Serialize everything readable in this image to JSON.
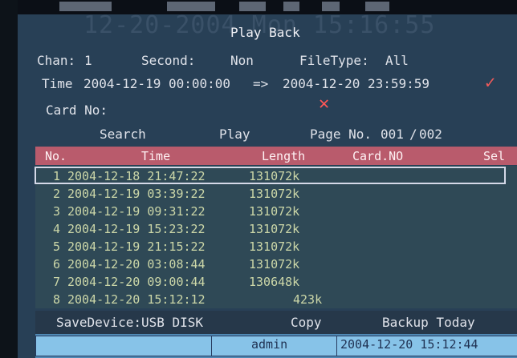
{
  "overlay": {
    "date_time": "12-20-2004 Mon 15:16:55"
  },
  "title": "Play Back",
  "filters": {
    "chan_label": "Chan:",
    "chan_value": "1",
    "second_label": "Second:",
    "second_value": "Non",
    "filetype_label": "FileType:",
    "filetype_value": "All"
  },
  "time_range": {
    "label": "Time",
    "start": "2004-12-19 00:00:00",
    "arrow": "=>",
    "end": "2004-12-20 23:59:59"
  },
  "card": {
    "label": "Card No:"
  },
  "actions": {
    "search": "Search",
    "play": "Play",
    "page_label": "Page No.",
    "page_current": "001",
    "page_sep": "/",
    "page_total": "002"
  },
  "table": {
    "headers": [
      "No.",
      "Time",
      "Length",
      "Card.NO",
      "Sel"
    ],
    "rows": [
      {
        "no": "1",
        "time": "2004-12-18 21:47:22",
        "length": "131072k"
      },
      {
        "no": "2",
        "time": "2004-12-19 03:39:22",
        "length": "131072k"
      },
      {
        "no": "3",
        "time": "2004-12-19 09:31:22",
        "length": "131072k"
      },
      {
        "no": "4",
        "time": "2004-12-19 15:23:22",
        "length": "131072k"
      },
      {
        "no": "5",
        "time": "2004-12-19 21:15:22",
        "length": "131072k"
      },
      {
        "no": "6",
        "time": "2004-12-20 03:08:44",
        "length": "131072k"
      },
      {
        "no": "7",
        "time": "2004-12-20 09:00:44",
        "length": "130648k"
      },
      {
        "no": "8",
        "time": "2004-12-20 15:12:12",
        "length": "423k"
      }
    ]
  },
  "footer": {
    "save_label": "SaveDevice:USB DISK",
    "copy": "Copy",
    "backup": "Backup Today",
    "user": "admin",
    "datetime": "2004-12-20 15:12:44"
  },
  "icons": {
    "check": "check-icon",
    "cross": "cross-icon"
  },
  "colors": {
    "table_header": "#b95b6c",
    "row_text": "#ccd7a8",
    "status_bar": "#4f89b5",
    "check_red": "#ef5a5a"
  }
}
